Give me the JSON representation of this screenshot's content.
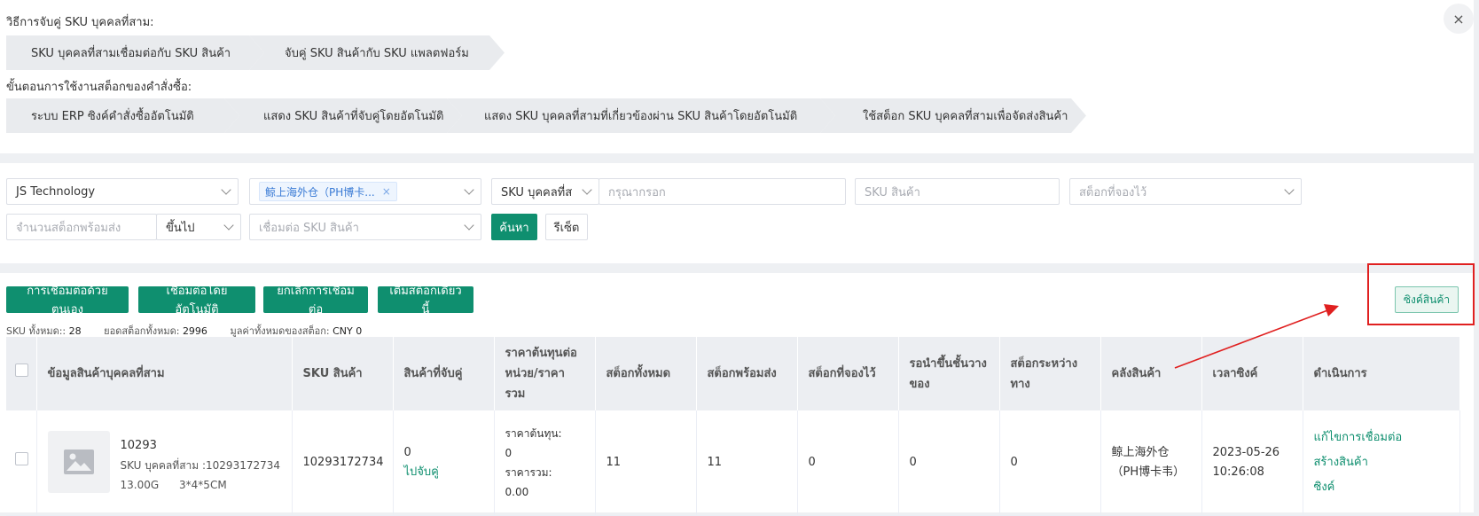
{
  "guide": {
    "section1_title": "วิธีการจับคู่ SKU บุคคลที่สาม:",
    "section1_steps": [
      "SKU บุคคลที่สามเชื่อมต่อกับ SKU สินค้า",
      "จับคู่ SKU สินค้ากับ SKU แพลตฟอร์ม"
    ],
    "section2_title": "ขั้นตอนการใช้งานสต็อกของคำสั่งซื้อ:",
    "section2_steps": [
      "ระบบ ERP ซิงค์คำสั่งซื้ออัตโนมัติ",
      "แสดง SKU สินค้าที่จับคู่โดยอัตโนมัติ",
      "แสดง SKU บุคคลที่สามที่เกี่ยวข้องผ่าน SKU สินค้าโดยอัตโนมัติ",
      "ใช้สต็อก SKU บุคคลที่สามเพื่อจัดส่งสินค้า"
    ],
    "close_symbol": "×"
  },
  "filters": {
    "company": "JS Technology",
    "warehouse_tag": "鲸上海外仓（PH博卡...",
    "tag_close": "×",
    "sku_type": "SKU บุคคลที่ส",
    "keyword_placeholder": "กรุณากรอก",
    "product_sku_placeholder": "SKU สินค้า",
    "reserved_stock_placeholder": "สต็อกที่จองไว้",
    "ready_qty_placeholder": "จำนวนสต็อกพร้อมส่ง",
    "compare": "ขึ้นไป",
    "link_status_placeholder": "เชื่อมต่อ SKU สินค้า",
    "search_label": "ค้นหา",
    "reset_label": "รีเซ็ต"
  },
  "actions": {
    "manual_link": "การเชื่อมต่อด้วยตนเอง",
    "auto_link": "เชื่อมต่อโดยอัตโนมัติ",
    "cancel_link": "ยกเลิกการเชื่อมต่อ",
    "add_stock_today": "เติมสต็อกเดี๋ยวนี้",
    "sync_products": "ซิงค์สินค้า"
  },
  "summary": {
    "sku_total_label": "SKU ทั้งหมด::",
    "sku_total": "28",
    "stock_total_label": "ยอดสต็อกทั้งหมด:",
    "stock_total": "2996",
    "value_label": "มูลค่าทั้งหมดของสต็อก:",
    "value": "CNY 0"
  },
  "table": {
    "headers": [
      "ข้อมูลสินค้าบุคคลที่สาม",
      "SKU สินค้า",
      "สินค้าที่จับคู่",
      "ราคาต้นทุนต่อหน่วย/ราคารวม",
      "สต็อกทั้งหมด",
      "สต็อกพร้อมส่ง",
      "สต็อกที่จองไว้",
      "รอนำขึ้นชั้นวางของ",
      "สต็อกระหว่างทาง",
      "คลังสินค้า",
      "เวลาซิงค์",
      "ดำเนินการ"
    ],
    "rows": [
      {
        "name": "10293",
        "third_sku": "SKU บุคคลที่สาม :10293172734",
        "spec": "13.00G      3*4*5CM",
        "product_sku": "10293172734",
        "matched_count": "0",
        "match_link": "ไปจับคู่",
        "unit_cost_label": "ราคาต้นทุน:",
        "unit_cost": "0",
        "total_label": "ราคารวม:",
        "total": "0.00",
        "stock_total": "11",
        "stock_ready": "11",
        "stock_reserved": "0",
        "stock_pending": "0",
        "stock_transit": "0",
        "warehouse": "鲸上海外仓（PH博卡韦）",
        "sync_time": "2023-05-26 10:26:08",
        "op_edit": "แก้ไขการเชื่อมต่อ",
        "op_create": "สร้างสินค้า",
        "op_sync": "ซิงค์"
      }
    ]
  },
  "colors": {
    "primary": "#0f8f6f",
    "annotation": "#e02020"
  }
}
